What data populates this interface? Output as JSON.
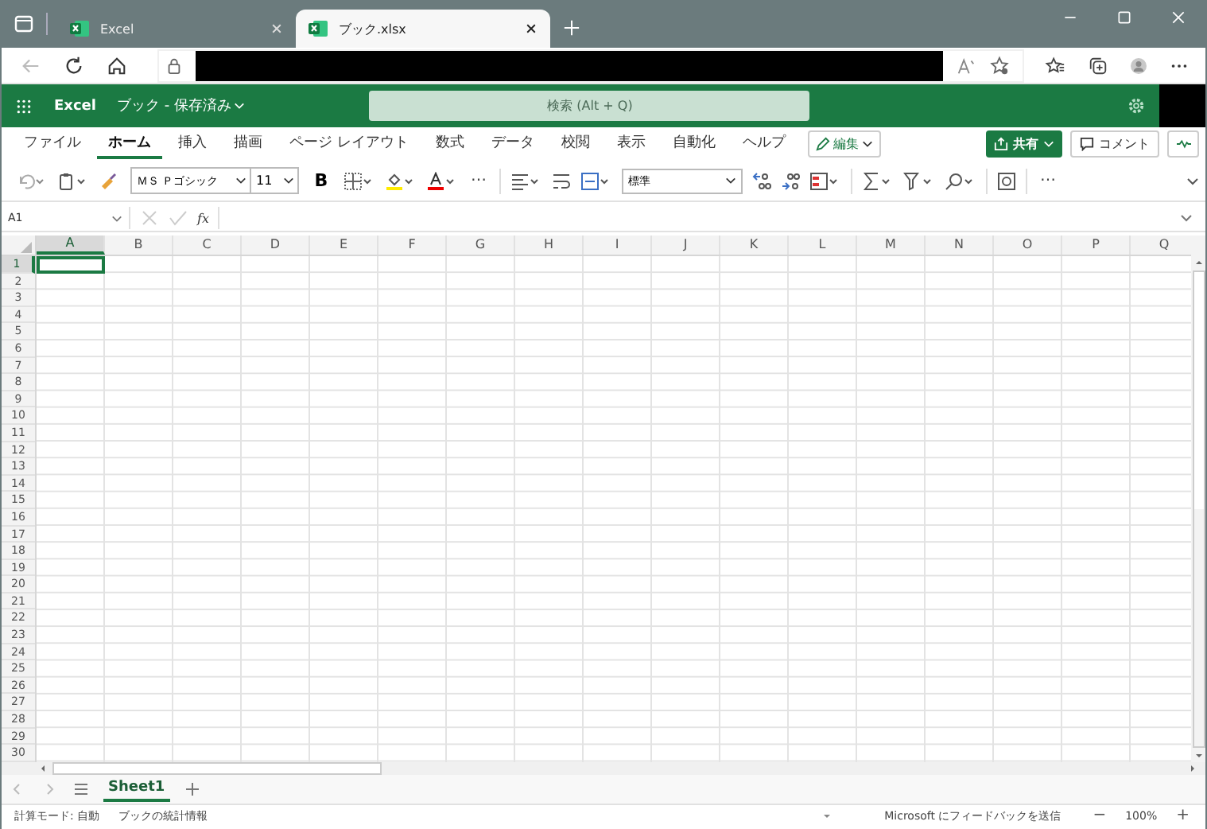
{
  "browser": {
    "tabs": [
      {
        "title": "Excel",
        "selected": false
      },
      {
        "title": "ブック.xlsx",
        "selected": true
      }
    ]
  },
  "app_bar": {
    "app_name": "Excel",
    "document": "ブック - 保存済み",
    "search": {
      "placeholder": "検索 (Alt + Q)"
    }
  },
  "ribbon": {
    "tabs": [
      {
        "label": "ファイル",
        "selected": false
      },
      {
        "label": "ホーム",
        "selected": true
      },
      {
        "label": "挿入",
        "selected": false
      },
      {
        "label": "描画",
        "selected": false
      },
      {
        "label": "ページ レイアウト",
        "selected": false
      },
      {
        "label": "数式",
        "selected": false
      },
      {
        "label": "データ",
        "selected": false
      },
      {
        "label": "校閲",
        "selected": false
      },
      {
        "label": "表示",
        "selected": false
      },
      {
        "label": "自動化",
        "selected": false
      },
      {
        "label": "ヘルプ",
        "selected": false
      }
    ],
    "edit_mode": "編集",
    "share": "共有",
    "comment": "コメント",
    "font_name": "ＭＳ Ｐゴシック",
    "font_size": "11",
    "bold": "B",
    "more": "⋯",
    "number_format": "標準",
    "more_right": "⋯"
  },
  "formula_bar": {
    "name_box": "A1",
    "fx": "fx"
  },
  "columns": [
    {
      "label": "A",
      "selected": true
    },
    {
      "label": "B",
      "selected": false
    },
    {
      "label": "C",
      "selected": false
    },
    {
      "label": "D",
      "selected": false
    },
    {
      "label": "E",
      "selected": false
    },
    {
      "label": "F",
      "selected": false
    },
    {
      "label": "G",
      "selected": false
    },
    {
      "label": "H",
      "selected": false
    },
    {
      "label": "I",
      "selected": false
    },
    {
      "label": "J",
      "selected": false
    },
    {
      "label": "K",
      "selected": false
    },
    {
      "label": "L",
      "selected": false
    },
    {
      "label": "M",
      "selected": false
    },
    {
      "label": "N",
      "selected": false
    },
    {
      "label": "O",
      "selected": false
    },
    {
      "label": "P",
      "selected": false
    },
    {
      "label": "Q",
      "selected": false
    }
  ],
  "rows": [
    {
      "label": "1",
      "selected": true
    },
    {
      "label": "2",
      "selected": false
    },
    {
      "label": "3",
      "selected": false
    },
    {
      "label": "4",
      "selected": false
    },
    {
      "label": "5",
      "selected": false
    },
    {
      "label": "6",
      "selected": false
    },
    {
      "label": "7",
      "selected": false
    },
    {
      "label": "8",
      "selected": false
    },
    {
      "label": "9",
      "selected": false
    },
    {
      "label": "10",
      "selected": false
    },
    {
      "label": "11",
      "selected": false
    },
    {
      "label": "12",
      "selected": false
    },
    {
      "label": "13",
      "selected": false
    },
    {
      "label": "14",
      "selected": false
    },
    {
      "label": "15",
      "selected": false
    },
    {
      "label": "16",
      "selected": false
    },
    {
      "label": "17",
      "selected": false
    },
    {
      "label": "18",
      "selected": false
    },
    {
      "label": "19",
      "selected": false
    },
    {
      "label": "20",
      "selected": false
    },
    {
      "label": "21",
      "selected": false
    },
    {
      "label": "22",
      "selected": false
    },
    {
      "label": "23",
      "selected": false
    },
    {
      "label": "24",
      "selected": false
    },
    {
      "label": "25",
      "selected": false
    },
    {
      "label": "26",
      "selected": false
    },
    {
      "label": "27",
      "selected": false
    },
    {
      "label": "28",
      "selected": false
    },
    {
      "label": "29",
      "selected": false
    },
    {
      "label": "30",
      "selected": false
    }
  ],
  "sheets": [
    {
      "name": "Sheet1",
      "selected": true
    }
  ],
  "status_bar": {
    "calc_mode": "計算モード: 自動",
    "stats": "ブックの統計情報",
    "feedback": "Microsoft にフィードバックを送信",
    "zoom_out": "−",
    "zoom": "100%",
    "zoom_in": "+"
  }
}
